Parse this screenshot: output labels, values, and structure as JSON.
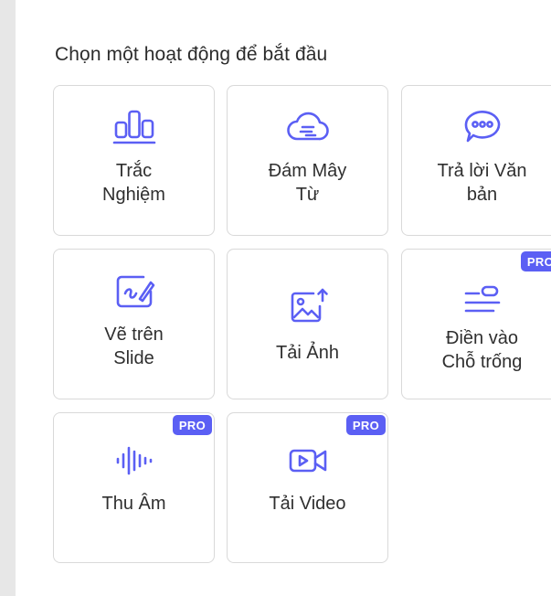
{
  "heading": "Chọn một hoạt động để bắt đầu",
  "accent_color": "#5b5ff4",
  "activities": [
    {
      "label_line1": "Trắc",
      "label_line2": "Nghiệm",
      "icon": "bar-chart-icon"
    },
    {
      "label_line1": "Đám Mây",
      "label_line2": "Từ",
      "icon": "cloud-icon"
    },
    {
      "label_line1": "Trả lời Văn",
      "label_line2": "bản",
      "icon": "chat-bubble-icon"
    },
    {
      "label_line1": "Vẽ trên",
      "label_line2": "Slide",
      "icon": "draw-icon"
    },
    {
      "label_line1": "Tải Ảnh",
      "icon": "image-upload-icon"
    },
    {
      "label_line1": "Điền vào",
      "label_line2": "Chỗ trống",
      "icon": "fill-blank-icon",
      "badge": "PRO"
    },
    {
      "label_line1": "Thu Âm",
      "icon": "audio-wave-icon",
      "badge": "PRO"
    },
    {
      "label_line1": "Tải Video",
      "icon": "video-icon",
      "badge": "PRO"
    }
  ]
}
